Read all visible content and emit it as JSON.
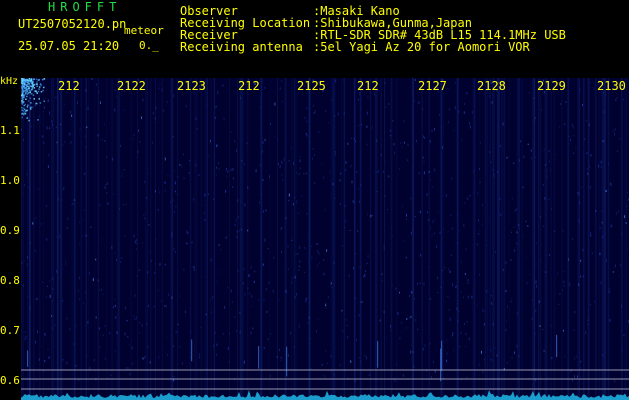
{
  "header": {
    "app_title": "HROFFT",
    "file_name": "UT2507052120.pn",
    "tag": "meteor",
    "timestamp": "25.07.05 21:20",
    "extra": "0._"
  },
  "info": [
    {
      "label": "Observer",
      "value": ":Masaki Kano"
    },
    {
      "label": "Receiving Location",
      "value": ":Shibukawa,Gunma,Japan"
    },
    {
      "label": "Receiver",
      "value": ":RTL-SDR SDR# 43dB L15 114.1MHz USB"
    },
    {
      "label": "Receiving antenna",
      "value": ":5el Yagi Az 20 for Aomori VOR"
    }
  ],
  "spectrogram": {
    "freq_unit": "kHz",
    "freq_ticks": [
      {
        "label": "1.1",
        "value": 1.1
      },
      {
        "label": "1.0",
        "value": 1.0
      },
      {
        "label": "0.9",
        "value": 0.9
      },
      {
        "label": "0.8",
        "value": 0.8
      },
      {
        "label": "0.7",
        "value": 0.7
      },
      {
        "label": "0.6",
        "value": 0.6
      }
    ],
    "time_ticks": [
      "212",
      "2122",
      "2123",
      "212",
      "2125",
      "212",
      "2127",
      "2128",
      "2129",
      "2130"
    ],
    "colors": {
      "background": "#010130",
      "signal": "#33ccff",
      "text": "#ffff00",
      "title": "#22dd44"
    }
  }
}
